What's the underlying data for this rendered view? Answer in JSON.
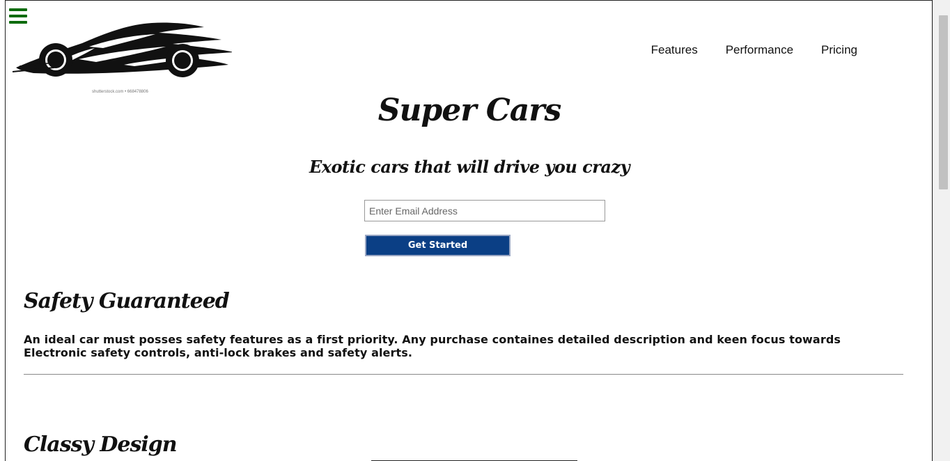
{
  "nav": {
    "menu_icon": "hamburger-icon",
    "items": [
      {
        "label": "Features"
      },
      {
        "label": "Performance"
      },
      {
        "label": "Pricing"
      }
    ]
  },
  "logo": {
    "caption": "shutterstock.com • 668478806"
  },
  "hero": {
    "title": "Super Cars",
    "subtitle": "Exotic cars that will drive you crazy",
    "email_placeholder": "Enter Email Address",
    "button_label": "Get Started"
  },
  "sections": [
    {
      "heading": "Safety Guaranteed",
      "body": "An ideal car must posses safety features as a first priority. Any purchase containes detailed description and keen focus towards Electronic safety controls, anti-lock brakes and safety alerts."
    },
    {
      "heading": "Classy Design"
    }
  ],
  "colors": {
    "menu_icon": "#0a6b0a",
    "button_bg": "#0b3f85",
    "button_text": "#ffffff"
  }
}
